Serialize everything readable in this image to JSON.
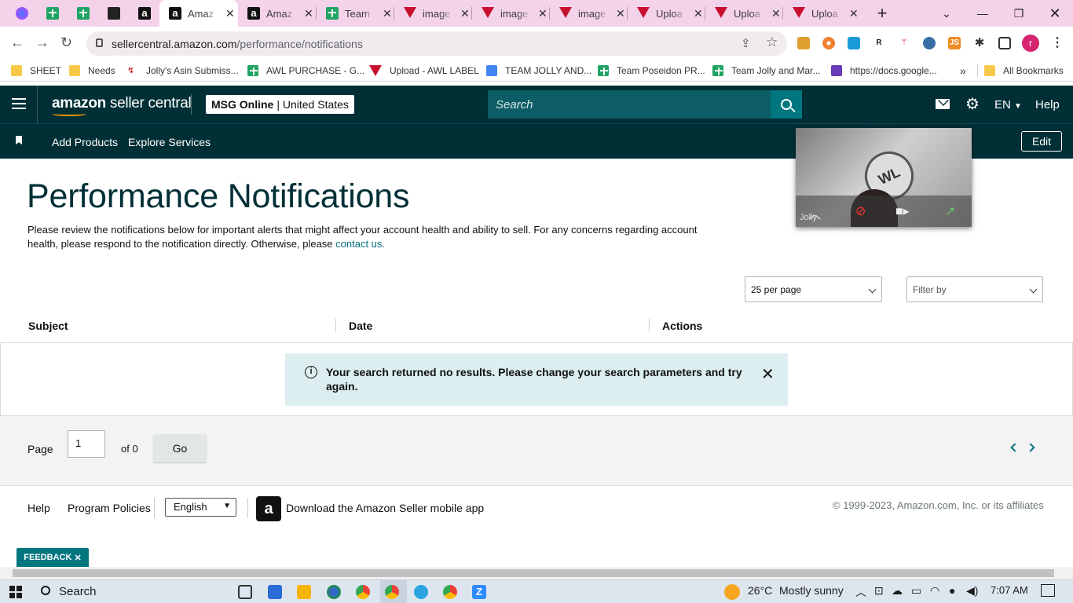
{
  "browser": {
    "tabs": [
      {
        "title": "Amaz",
        "icon": "amazon-favicon",
        "active": true
      },
      {
        "title": "Amaz",
        "icon": "amazon-favicon"
      },
      {
        "title": "Team",
        "icon": "sheets-favicon"
      },
      {
        "title": "image",
        "icon": "v-favicon"
      },
      {
        "title": "image",
        "icon": "v-favicon"
      },
      {
        "title": "image",
        "icon": "v-favicon"
      },
      {
        "title": "Uploa",
        "icon": "v-favicon"
      },
      {
        "title": "Uploa",
        "icon": "v-favicon"
      },
      {
        "title": "Uploa",
        "icon": "v-favicon"
      }
    ],
    "url_domain": "sellercentral.amazon.com",
    "url_path": "/performance/notifications",
    "profile_initial": "r",
    "bookmarks": [
      "SHEET",
      "Needs",
      "Jolly's Asin Submiss...",
      "AWL PURCHASE - G...",
      "Upload - AWL LABEL",
      "TEAM JOLLY AND...",
      "Team Poseidon PR...",
      "Team Jolly and Mar...",
      "https://docs.google..."
    ],
    "bookmarks_overflow": "»",
    "all_bookmarks": "All Bookmarks"
  },
  "header": {
    "brand_bold": "amazon",
    "brand_light": " seller central",
    "market_store": "MSG Online",
    "market_region": "| United States",
    "search_placeholder": "Search",
    "language": "EN",
    "help": "Help"
  },
  "subnav": {
    "items": [
      "Add Products",
      "Explore Services"
    ],
    "edit": "Edit"
  },
  "video_overlay": {
    "name": "Jolly"
  },
  "page": {
    "title": "Performance Notifications",
    "intro": "Please review the notifications below for important alerts that might affect your account health and ability to sell. For any concerns regarding account health, please respond to the notification directly. Otherwise, please ",
    "intro_link": "contact us.",
    "per_page": "25 per page",
    "filter_by": "Filter by",
    "columns": [
      "Subject",
      "Date",
      "Actions"
    ],
    "empty_message": "Your search returned no results. Please change your search parameters and try again."
  },
  "pagination": {
    "page_label": "Page",
    "page_value": "1",
    "of_label": "of 0",
    "go": "Go"
  },
  "footer": {
    "help": "Help",
    "program_policies": "Program Policies",
    "language": "English",
    "app_download": "Download the Amazon Seller mobile app",
    "copyright": "© 1999-2023, Amazon.com, Inc. or its affiliates",
    "feedback": "FEEDBACK"
  },
  "taskbar": {
    "search": "Search",
    "weather_temp": "26°C",
    "weather_text": "Mostly sunny",
    "time": "7:07 AM"
  },
  "colors": {
    "header_bg": "#002f36",
    "accent": "#00767f",
    "alert_bg": "#dceeef",
    "tab_strip": "#f4d2ea"
  }
}
